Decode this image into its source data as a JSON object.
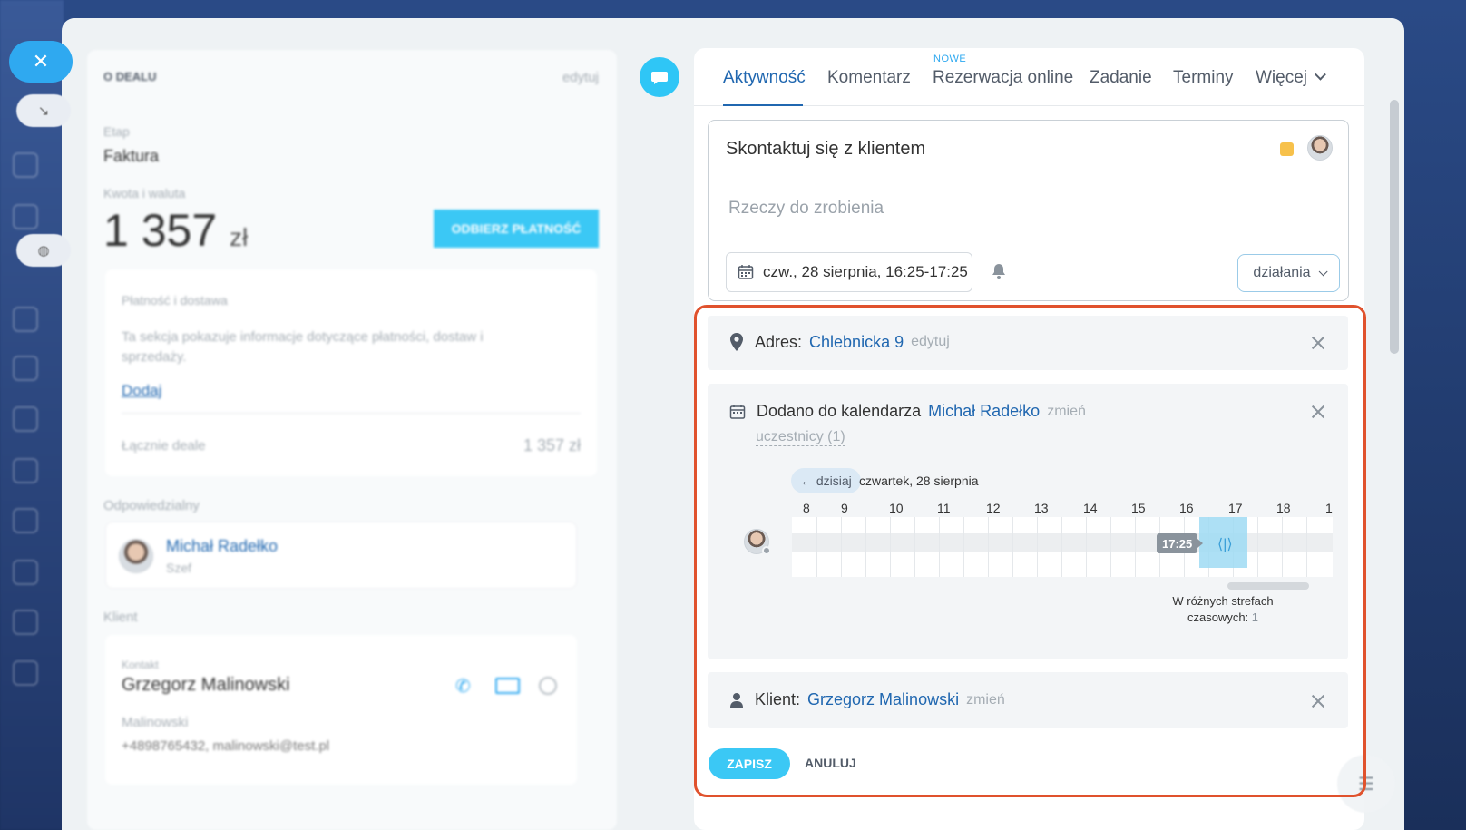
{
  "close_button": {
    "icon": "close-icon"
  },
  "deal": {
    "section_title": "O DEALU",
    "edit_label": "edytuj",
    "stage_label": "Etap",
    "stage_value": "Faktura",
    "amount_label": "Kwota i waluta",
    "amount_value": "1 357",
    "amount_currency": "zł",
    "receive_payment_label": "ODBIERZ PŁATNOŚĆ",
    "payment": {
      "title": "Płatność i dostawa",
      "description": "Ta sekcja pokazuje informacje dotyczące płatności, dostaw i sprzedaży.",
      "add_link": "Dodaj",
      "total_label": "Łącznie deale",
      "total_value": "1 357 zł"
    },
    "responsible_label": "Odpowiedzialny",
    "responsible_name": "Michał Radełko",
    "responsible_role": "Szef",
    "client_label": "Klient",
    "contact_label": "Kontakt",
    "contact_name": "Grzegorz Malinowski",
    "company": "Malinowski",
    "contact_info": "+4898765432, malinowski@test.pl"
  },
  "tabs": {
    "items": [
      "Aktywność",
      "Komentarz",
      "Rezerwacja online",
      "Zadanie",
      "Terminy",
      "Więcej"
    ],
    "badge": "NOWE",
    "active": "Aktywność"
  },
  "editor": {
    "title": "Skontaktuj się z klientem",
    "placeholder": "Rzeczy do zrobienia",
    "date": "czw., 28 sierpnia, 16:25-17:25",
    "actions_label": "działania",
    "flag_color": "#f7c14b"
  },
  "address_block": {
    "label": "Adres:",
    "value": "Chlebnicka 9",
    "edit": "edytuj"
  },
  "calendar_block": {
    "label": "Dodano do kalendarza",
    "user": "Michał Radełko",
    "change": "zmień",
    "participants": "uczestnicy (1)",
    "today": "← dzisiaj",
    "day": "czwartek, 28 sierpnia",
    "hours": [
      "8",
      "9",
      "10",
      "11",
      "12",
      "13",
      "14",
      "15",
      "16",
      "17",
      "18",
      "1"
    ],
    "selected_end": "17:25",
    "timezone_note_1": "W różnych strefach",
    "timezone_note_2": "czasowych:",
    "timezone_count": "1"
  },
  "client_block": {
    "label": "Klient:",
    "value": "Grzegorz Malinowski",
    "change": "zmień"
  },
  "footer": {
    "save": "ZAPISZ",
    "cancel": "ANULUJ"
  },
  "colors": {
    "accent": "#2067b0",
    "primary_button": "#3bc8f5",
    "highlight": "#e0522d"
  }
}
